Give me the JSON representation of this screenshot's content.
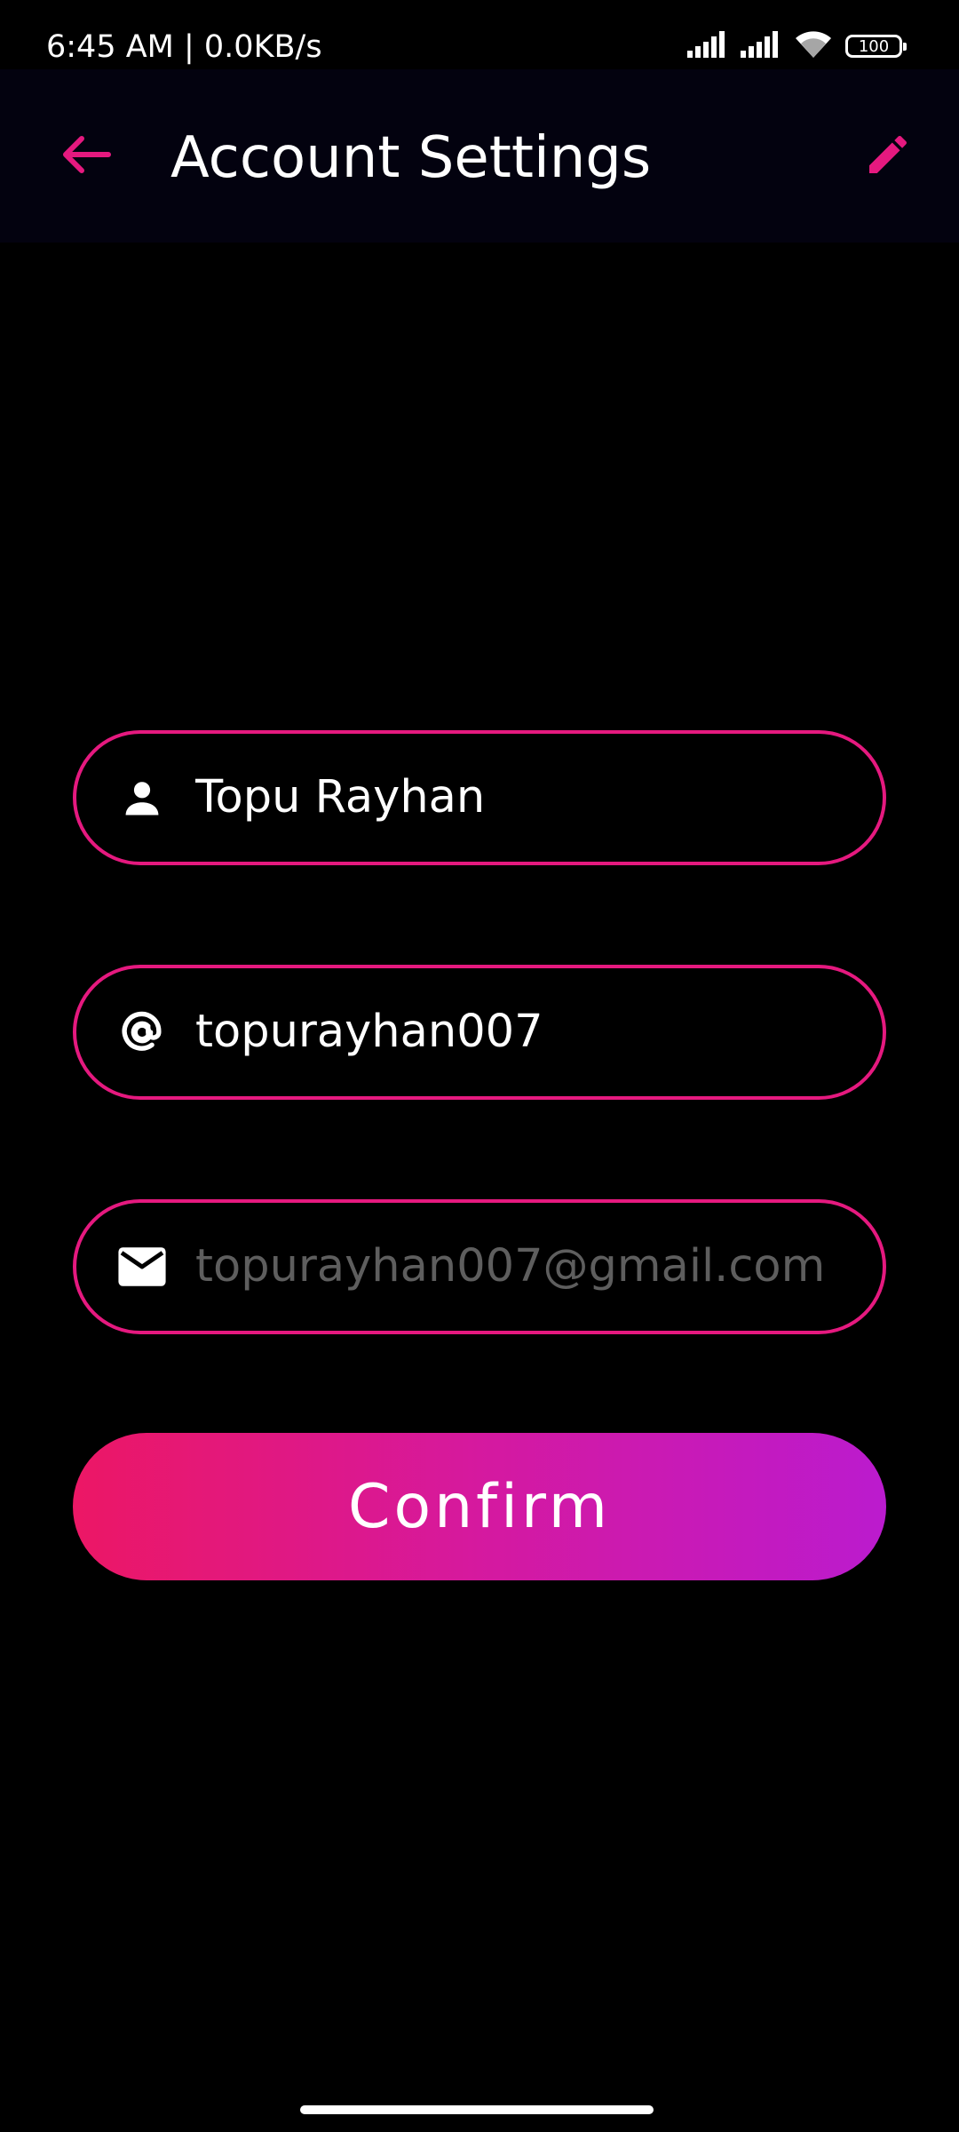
{
  "status_bar": {
    "time_text": "6:45 AM | 0.0KB/s",
    "battery_level": "100",
    "icons": [
      "signal-icon",
      "signal-icon",
      "wifi-icon",
      "battery-icon"
    ]
  },
  "app_bar": {
    "title": "Account Settings",
    "back_icon": "arrow-left-icon",
    "edit_icon": "pencil-icon",
    "accent_color": "#e5197f"
  },
  "form": {
    "name": {
      "icon": "person-icon",
      "value": "Topu Rayhan"
    },
    "username": {
      "icon": "at-sign-icon",
      "value": "topurayhan007"
    },
    "email": {
      "icon": "envelope-icon",
      "placeholder": "topurayhan007@gmail.com"
    },
    "confirm_label": "Confirm"
  },
  "colors": {
    "background": "#000000",
    "app_bar_bg": "#03020f",
    "field_border": "#e5197f",
    "button_gradient_start": "#ec1765",
    "button_gradient_end": "#bb1bce",
    "placeholder_text": "#5e5e5e"
  }
}
